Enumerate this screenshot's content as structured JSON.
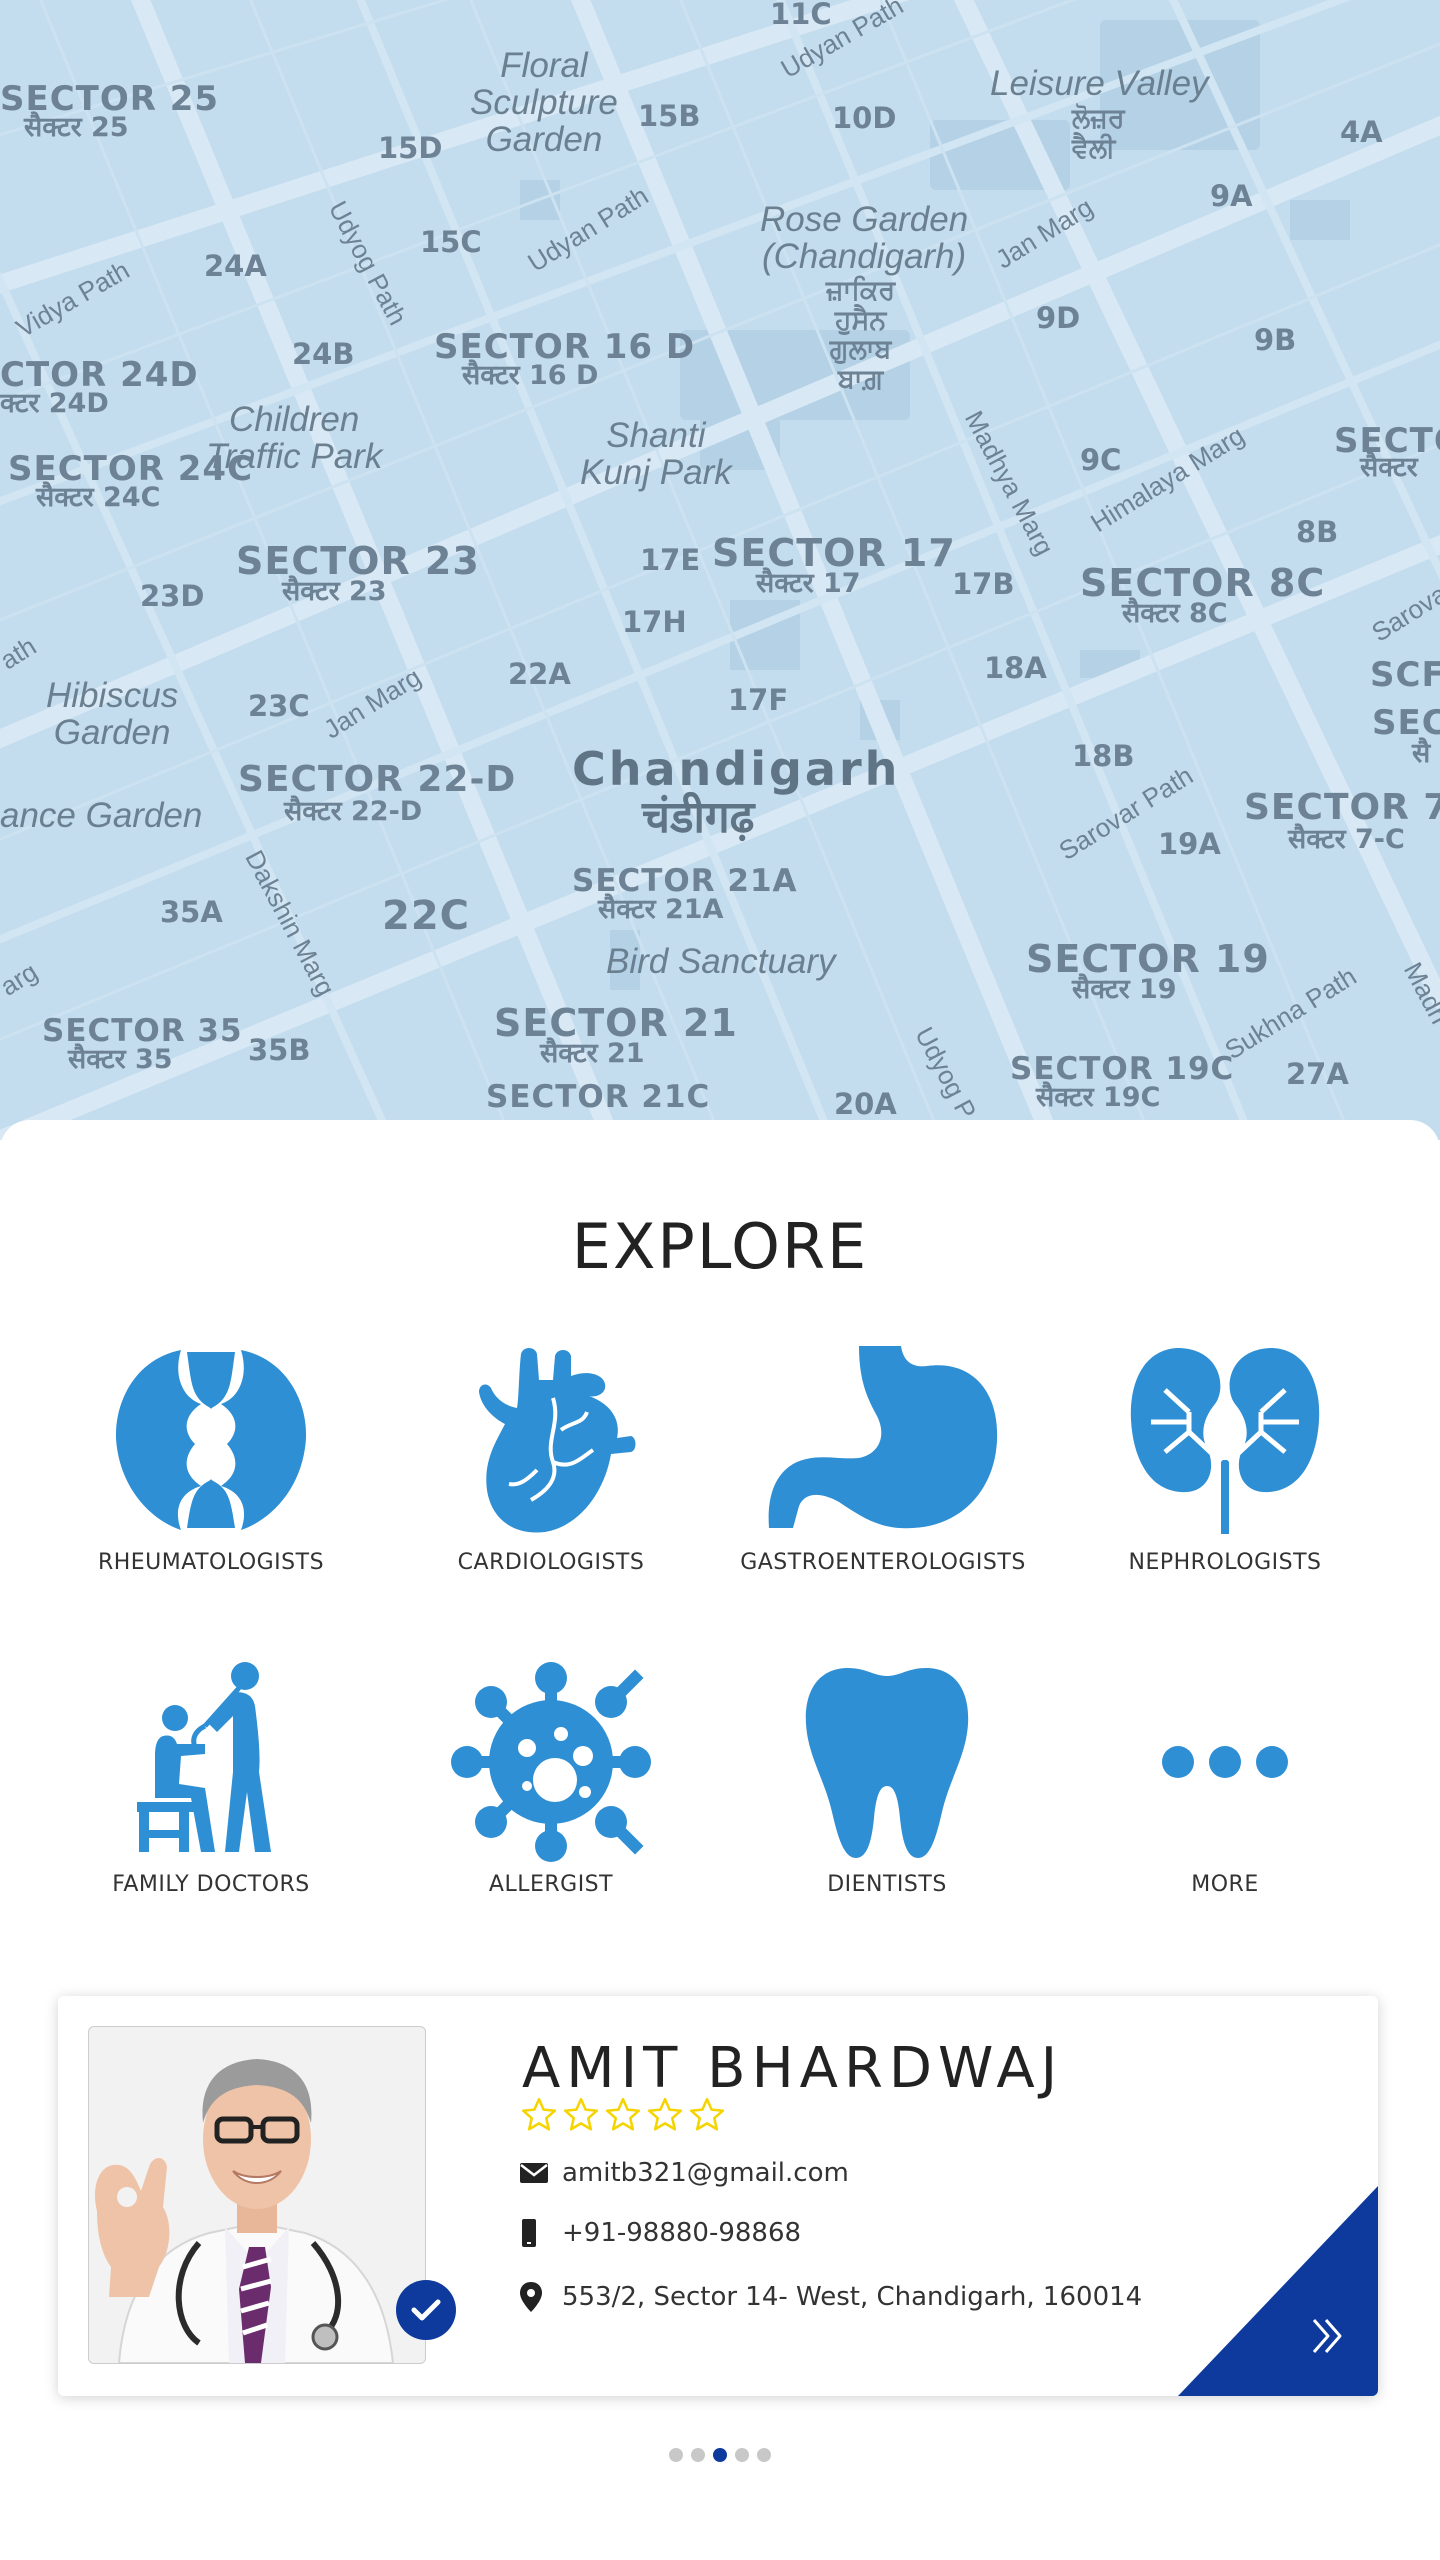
{
  "map": {
    "labels": {
      "l1": "SECTOR 25",
      "l2": "सैक्टर 25",
      "l3": "Floral\nSculpture\nGarden",
      "l4": "15B",
      "l5": "10D",
      "l6": "Leisure Valley",
      "l7": "ਲੋਜ਼ਰ\nਵੈਲੀ",
      "l8": "4A",
      "l9": "15D",
      "l10": "Udyan Path",
      "l11": "9A",
      "l12": "Rose Garden\n(Chandigarh)",
      "l13": "ਜ਼ਾਕਿਰ\nਹੁਸੈਨ\nਗੁਲਾਬ\nਬਾਗ਼",
      "l14": "Jan Marg",
      "l15": "Vidya Path",
      "l16": "24A",
      "l17": "15C",
      "l18": "Udyog Path",
      "l19": "Udyan Path",
      "l20": "9D",
      "l21": "9B",
      "l22": "CTOR 24D",
      "l23": "क्टर 24D",
      "l24": "24B",
      "l25": "SECTOR 16 D",
      "l26": "सैक्टर 16 D",
      "l27": "Children\nTraffic Park",
      "l28": "Shanti\nKunj Park",
      "l29": "Madhya Marg",
      "l30": "9C",
      "l31": "Himalaya Marg",
      "l32": "SECTO",
      "l33": "सैक्टर",
      "l34": "SECTOR 24C",
      "l35": "सैक्टर 24C",
      "l36": "SECTOR 23",
      "l37": "सैक्टर 23",
      "l38": "17E",
      "l39": "SECTOR 17",
      "l40": "सैक्टर 17",
      "l41": "17B",
      "l42": "SECTOR 8C",
      "l43": "सैक्टर 8C",
      "l44": "8B",
      "l45": "23D",
      "l46": "17H",
      "l47": "Hibiscus\nGarden",
      "l48": "23C",
      "l49": "Jan Marg",
      "l50": "22A",
      "l51": "18A",
      "l52": "17F",
      "l53": "SCF",
      "l54": "SEC",
      "l55": "सै",
      "l56": "Chandigarh",
      "l57": "चंडीगढ़",
      "l58": "18B",
      "l59": "SECTOR 22-D",
      "l60": "सैक्टर 22-D",
      "l61": "ance Garden",
      "l62": "Sarovar Path",
      "l63": "19A",
      "l64": "SECTOR 7-",
      "l65": "सैक्टर 7-C",
      "l66": "Dakshin Marg",
      "l67": "35A",
      "l68": "22C",
      "l69": "SECTOR 21A",
      "l70": "सैक्टर 21A",
      "l71": "Bird Sanctuary",
      "l72": "SECTOR 19",
      "l73": "सैक्टर 19",
      "l74": "SECTOR 35",
      "l75": "सैक्टर 35",
      "l76": "35B",
      "l77": "SECTOR 21",
      "l78": "सैक्टर 21",
      "l79": "SECTOR 19C",
      "l80": "सैक्टर 19C",
      "l81": "27A",
      "l82": "Sukhna Path",
      "l83": "SECTOR 21C",
      "l84": "20A",
      "l85": "Udyog P",
      "l86": "11C",
      "l87": "Sarova",
      "l88": "Udyan Path",
      "l89": "ath",
      "l90": "arg",
      "l91": "Madh"
    }
  },
  "explore": {
    "title": "EXPLORE",
    "categories": [
      {
        "label": "RHEUMATOLOGISTS",
        "icon": "joint-icon"
      },
      {
        "label": "CARDIOLOGISTS",
        "icon": "heart-icon"
      },
      {
        "label": "GASTROENTEROLOGISTS",
        "icon": "stomach-icon"
      },
      {
        "label": "NEPHROLOGISTS",
        "icon": "kidney-icon"
      },
      {
        "label": "FAMILY DOCTORS",
        "icon": "doctor-patient-icon"
      },
      {
        "label": "ALLERGIST",
        "icon": "virus-icon"
      },
      {
        "label": "DIENTISTS",
        "icon": "tooth-icon"
      },
      {
        "label": "MORE",
        "icon": "more-dots-icon"
      }
    ]
  },
  "doctor_card": {
    "name": "AMIT BHARDWAJ",
    "rating": 0,
    "rating_max": 5,
    "email": "amitb321@gmail.com",
    "phone": "+91-98880-98868",
    "address": "553/2, Sector 14- West, Chandigarh, 160014",
    "verified_icon": "check-icon",
    "next_icon": "double-chevron-right-icon"
  },
  "pager": {
    "count": 5,
    "active_index": 2
  },
  "colors": {
    "accent": "#2e8fd4",
    "brand_dark": "#0d3a9c",
    "map_bg": "#c3dcee",
    "star": "#f5d400"
  }
}
